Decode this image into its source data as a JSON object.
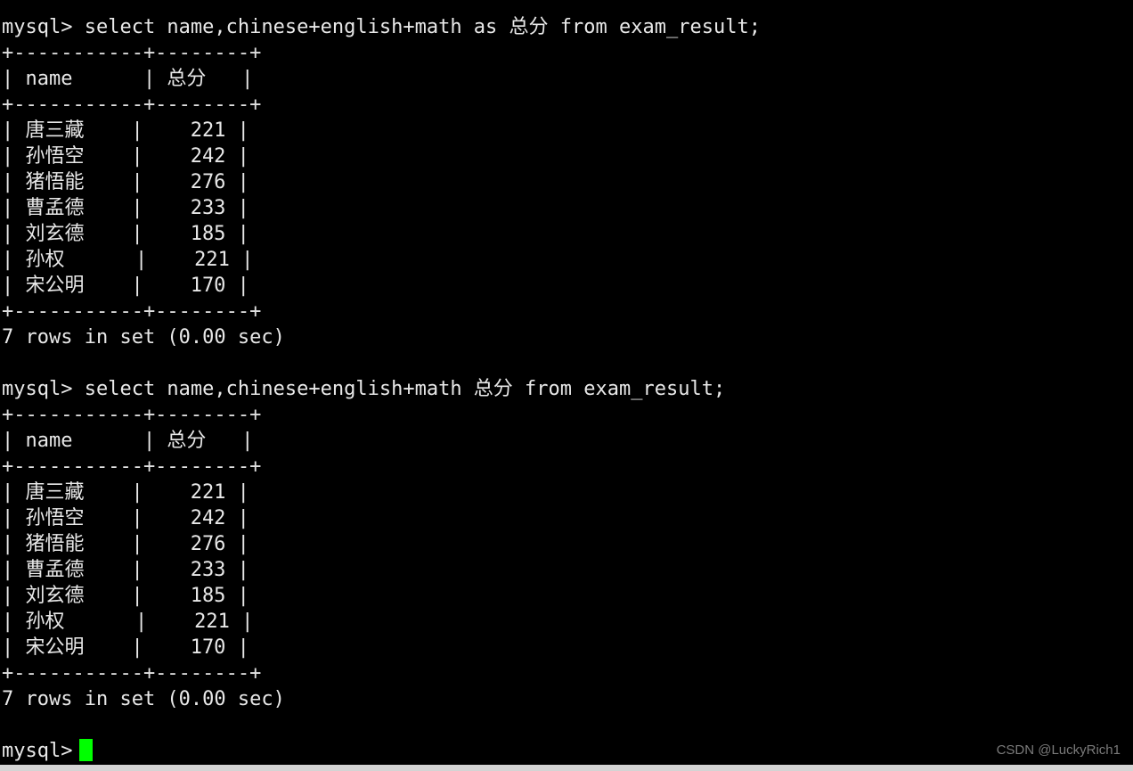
{
  "terminal": {
    "background_color": "#000000",
    "foreground_color": "#e8e8e8",
    "cursor_color": "#00ff00",
    "prompt": "mysql>",
    "queries": {
      "first": "mysql> select name,chinese+english+math as 总分 from exam_result;",
      "second": "mysql> select name,chinese+english+math 总分 from exam_result;"
    },
    "table": {
      "border": "+-----------+--------+",
      "header_row": "| name      | 总分   |",
      "columns": [
        "name",
        "总分"
      ],
      "rows": [
        {
          "name": "唐三藏",
          "total": "221",
          "text": "| 唐三藏    |    221 |"
        },
        {
          "name": "孙悟空",
          "total": "242",
          "text": "| 孙悟空    |    242 |"
        },
        {
          "name": "猪悟能",
          "total": "276",
          "text": "| 猪悟能    |    276 |"
        },
        {
          "name": "曹孟德",
          "total": "233",
          "text": "| 曹孟德    |    233 |"
        },
        {
          "name": "刘玄德",
          "total": "185",
          "text": "| 刘玄德    |    185 |"
        },
        {
          "name": "孙权",
          "total": "221",
          "text": "| 孙权      |    221 |"
        },
        {
          "name": "宋公明",
          "total": "170",
          "text": "| 宋公明    |    170 |"
        }
      ]
    },
    "result_status": "7 rows in set (0.00 sec)",
    "final_prompt": "mysql>"
  },
  "watermark": "CSDN @LuckyRich1"
}
